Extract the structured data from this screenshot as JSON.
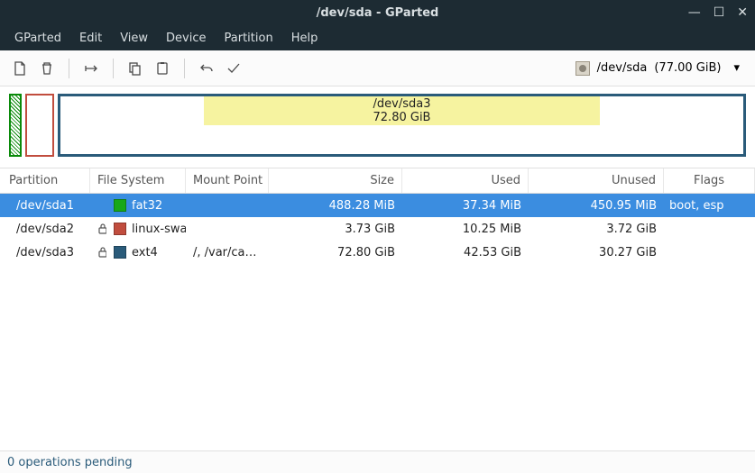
{
  "window": {
    "title": "/dev/sda - GParted"
  },
  "menu": {
    "items": [
      "GParted",
      "Edit",
      "View",
      "Device",
      "Partition",
      "Help"
    ]
  },
  "device": {
    "name": "/dev/sda",
    "size": "(77.00 GiB)"
  },
  "map": {
    "big_label": "/dev/sda3",
    "big_size": "72.80 GiB",
    "used_pct": 58
  },
  "colors": {
    "fat32": "#18a818",
    "swap": "#c14d3e",
    "ext4": "#2a5b7a"
  },
  "columns": {
    "partition": "Partition",
    "filesystem": "File System",
    "mountpoint": "Mount Point",
    "size": "Size",
    "used": "Used",
    "unused": "Unused",
    "flags": "Flags"
  },
  "rows": [
    {
      "partition": "/dev/sda1",
      "locked": false,
      "fs": "fat32",
      "fs_color": "#18a818",
      "mount": "",
      "size": "488.28 MiB",
      "used": "37.34 MiB",
      "unused": "450.95 MiB",
      "flags": "boot, esp",
      "selected": true
    },
    {
      "partition": "/dev/sda2",
      "locked": true,
      "fs": "linux-swap",
      "fs_color": "#c14d3e",
      "mount": "",
      "size": "3.73 GiB",
      "used": "10.25 MiB",
      "unused": "3.72 GiB",
      "flags": "",
      "selected": false
    },
    {
      "partition": "/dev/sda3",
      "locked": true,
      "fs": "ext4",
      "fs_color": "#2a5b7a",
      "mount": "/, /var/cach...",
      "size": "72.80 GiB",
      "used": "42.53 GiB",
      "unused": "30.27 GiB",
      "flags": "",
      "selected": false
    }
  ],
  "status": {
    "text": "0 operations pending"
  }
}
